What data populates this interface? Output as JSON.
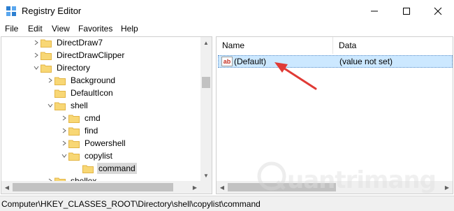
{
  "window": {
    "title": "Registry Editor",
    "icon": "registry-icon",
    "controls": [
      "minimize-icon",
      "maximize-icon",
      "close-icon"
    ]
  },
  "menu": {
    "items": [
      "File",
      "Edit",
      "View",
      "Favorites",
      "Help"
    ]
  },
  "tree": {
    "rows": [
      {
        "label": "DirectDraw7",
        "expander": "collapsed"
      },
      {
        "label": "DirectDrawClipper",
        "expander": "collapsed"
      },
      {
        "label": "Directory",
        "expander": "expanded"
      },
      {
        "label": "Background",
        "expander": "collapsed"
      },
      {
        "label": "DefaultIcon",
        "expander": "none"
      },
      {
        "label": "shell",
        "expander": "expanded"
      },
      {
        "label": "cmd",
        "expander": "collapsed"
      },
      {
        "label": "find",
        "expander": "collapsed"
      },
      {
        "label": "Powershell",
        "expander": "collapsed"
      },
      {
        "label": "copylist",
        "expander": "expanded"
      },
      {
        "label": "command",
        "expander": "none",
        "selected": true
      },
      {
        "label": "shellex",
        "expander": "collapsed"
      }
    ]
  },
  "values_list": {
    "headers": {
      "name": "Name",
      "data": "Data"
    },
    "rows": [
      {
        "icon": "string-value-icon",
        "icon_text": "ab",
        "name": "(Default)",
        "data": "(value not set)",
        "selected": true
      }
    ]
  },
  "watermark": {
    "text": "uantrimang"
  },
  "status_bar": {
    "path": "Computer\\HKEY_CLASSES_ROOT\\Directory\\shell\\copylist\\command"
  },
  "colors": {
    "selection": "#cce8ff",
    "annotation_arrow": "#e03a35",
    "folder": "#f8d775",
    "folder_dark": "#e3b545"
  }
}
